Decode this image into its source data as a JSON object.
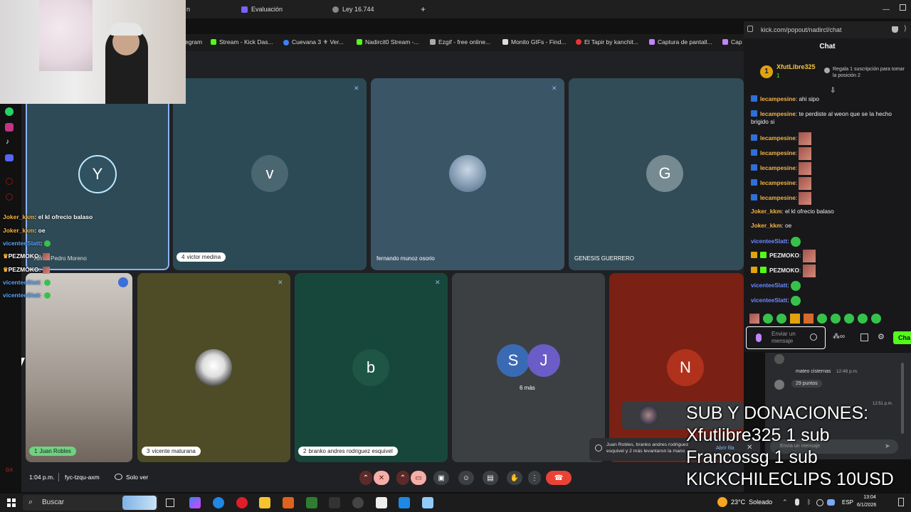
{
  "browser": {
    "tabs": [
      "Evaluación",
      "Ley 16.744"
    ],
    "tab_partial": "n",
    "new_tab": "+",
    "bookmarks": [
      "egram",
      "Stream - Kick Das...",
      "Cuevana 3 ⚜ Ver...",
      "Nadircit0 Stream -...",
      "Ezgif - free online...",
      "Monito GIFs - Find...",
      "El Tapir by kanchit...",
      "Captura de pantall...",
      "Cap"
    ],
    "popup_url": "kick.com/popout/nadircl/chat"
  },
  "meet": {
    "tiles_top": [
      {
        "letter": "Y",
        "name": "Alfred Pedro Moreno"
      },
      {
        "letter": "v",
        "name": "victor medina",
        "count": "4"
      },
      {
        "letter": "",
        "name": "fernando munoz osorio"
      },
      {
        "letter": "G",
        "name": "GENESIS GUERRERO"
      }
    ],
    "tiles_bottom": [
      {
        "name": "Juan Robles",
        "count": "1"
      },
      {
        "name": "vicente maturana",
        "count": "3"
      },
      {
        "letter": "b",
        "name": "branko andres rodriguez esquivel",
        "count": "2"
      },
      {
        "letters": [
          "S",
          "J"
        ],
        "more": "6 más"
      },
      {
        "letter": "N"
      }
    ],
    "time": "1:04 p.m.",
    "meeting_code": "fyc-tzqu-axm",
    "solo_ver": "Solo ver",
    "raised_hands": "Juan Robles, branko andres rodriguez esquivel y 2 más levantaron la mano",
    "open_queue": "Abrir fila"
  },
  "chat": {
    "header": "Chat",
    "top_user": "XfutLibre325",
    "top_count": "1",
    "gift_prompt": "Regala 1 suscripción para tomar la posición 2",
    "messages": [
      {
        "user": "lecampesine",
        "text": "ahi sipo"
      },
      {
        "user": "lecampesine",
        "text": "te perdiste al weon que se la hecho brigido si"
      },
      {
        "user": "lecampesine",
        "text": ""
      },
      {
        "user": "lecampesine",
        "text": ""
      },
      {
        "user": "lecampesine",
        "text": ""
      },
      {
        "user": "lecampesine",
        "text": ""
      },
      {
        "user": "lecampesine",
        "text": ""
      },
      {
        "user": "Joker_kkm",
        "text": "el kl ofrecio balaso"
      },
      {
        "user": "Joker_kkm",
        "text": "oe"
      },
      {
        "user": "vicenteeSlatt",
        "text": ""
      },
      {
        "user": "PEZMOKO",
        "text": ""
      },
      {
        "user": "PEZMOKO",
        "text": ""
      },
      {
        "user": "vicenteeSlatt",
        "text": ""
      },
      {
        "user": "vicenteeSlatt",
        "text": ""
      }
    ],
    "input_placeholder": "Enviar un mensaje",
    "send_label": "Cha"
  },
  "overlay_chat": [
    {
      "user": "Joker_kkm",
      "text": "el kl ofrecio balaso"
    },
    {
      "user": "Joker_kkm",
      "text": "oe"
    },
    {
      "user": "vicenteeSlatt",
      "text": ""
    },
    {
      "user": "PEZMOKO",
      "text": ""
    },
    {
      "user": "PEZMOKO",
      "text": ""
    },
    {
      "user": "vicenteeSlatt",
      "text": ""
    },
    {
      "user": "vicenteeSlatt",
      "text": ""
    }
  ],
  "meet_chat": {
    "user": "mateo cisternas",
    "time": "12:48 p.m.",
    "points": "29 puntos",
    "time2": "12:51 p.m.",
    "input": "Envía un mensaje"
  },
  "donations": [
    "SUB Y DONACIONES:",
    "Xfutlibre325 1 sub",
    "Francossg 1 sub",
    "KICKCHILECLIPS 10USD"
  ],
  "taskbar": {
    "search": "Buscar",
    "weather": "23°C  Soleado",
    "lang": "ESP",
    "clock_time": "13:04",
    "clock_date": "6/1/2026"
  }
}
